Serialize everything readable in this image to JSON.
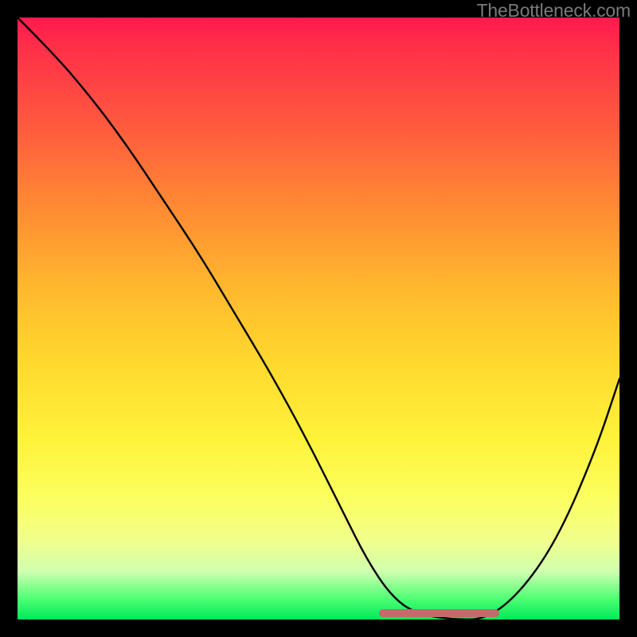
{
  "watermark_text": "TheBottleneck.com",
  "chart_data": {
    "type": "line",
    "title": "",
    "xlabel": "",
    "ylabel": "",
    "xlim": [
      0,
      100
    ],
    "ylim": [
      0,
      100
    ],
    "series": [
      {
        "name": "bottleneck-curve",
        "x": [
          0,
          6,
          12,
          18,
          24,
          30,
          36,
          42,
          48,
          54,
          58,
          62,
          66,
          72,
          78,
          84,
          90,
          96,
          100
        ],
        "values": [
          100,
          94,
          87,
          79,
          70,
          61,
          51,
          41,
          30,
          18,
          10,
          4,
          1,
          0,
          0,
          5,
          14,
          28,
          40
        ]
      }
    ],
    "valley_marker": {
      "x_start": 60,
      "x_end": 80,
      "y": 1
    },
    "background_gradient": {
      "top": "#ff1a4d",
      "mid": "#fff23a",
      "bottom": "#00e85a"
    }
  }
}
